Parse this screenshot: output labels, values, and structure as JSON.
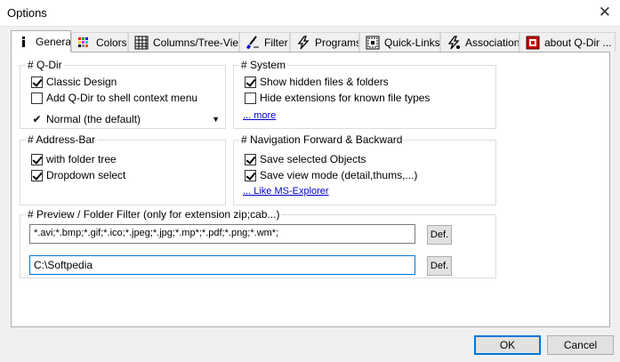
{
  "window": {
    "title": "Options",
    "close_glyph": "✕"
  },
  "tabs": [
    {
      "label": "General",
      "icon": "info-icon",
      "active": true
    },
    {
      "label": "Colors",
      "icon": "color-palette-icon"
    },
    {
      "label": "Columns/Tree-View",
      "icon": "columns-grid-icon"
    },
    {
      "label": "Filter",
      "icon": "filter-brush-icon"
    },
    {
      "label": "Programs",
      "icon": "lightning-icon"
    },
    {
      "label": "Quick-Links",
      "icon": "quick-links-icon"
    },
    {
      "label": "Association",
      "icon": "association-lightning-icon"
    },
    {
      "label": "about Q-Dir ...",
      "icon": "about-red-icon"
    }
  ],
  "groups": {
    "qdir": {
      "title": "# Q-Dir",
      "classic_design": {
        "label": "Classic Design",
        "checked": true
      },
      "shell_context": {
        "label": "Add Q-Dir to shell context menu",
        "checked": false
      },
      "mode_check_glyph": "✔",
      "mode_value": "Normal (the default)",
      "dropdown_glyph": "▼"
    },
    "system": {
      "title": "# System",
      "show_hidden": {
        "label": "Show hidden files & folders",
        "checked": true
      },
      "hide_ext": {
        "label": "Hide extensions for known file types",
        "checked": false
      },
      "more_link": "... more"
    },
    "address_bar": {
      "title": "# Address-Bar",
      "folder_tree": {
        "label": "with folder tree",
        "checked": true
      },
      "dropdown_select": {
        "label": "Dropdown select",
        "checked": true
      }
    },
    "navigation": {
      "title": "# Navigation Forward & Backward",
      "save_objects": {
        "label": "Save selected Objects",
        "checked": true
      },
      "save_view": {
        "label": "Save view mode (detail,thums,...)",
        "checked": true
      },
      "ms_explorer_link": "... Like MS-Explorer"
    },
    "preview": {
      "title": "# Preview / Folder Filter (only for extension zip;cab...)",
      "extensions_value": "*.avi;*.bmp;*.gif;*.ico;*.jpeg;*.jpg;*.mp*;*.pdf;*.png;*.wm*;",
      "folder_value": "C:\\Softpedia",
      "def_label": "Def."
    }
  },
  "footer": {
    "ok_label": "OK",
    "cancel_label": "Cancel"
  }
}
